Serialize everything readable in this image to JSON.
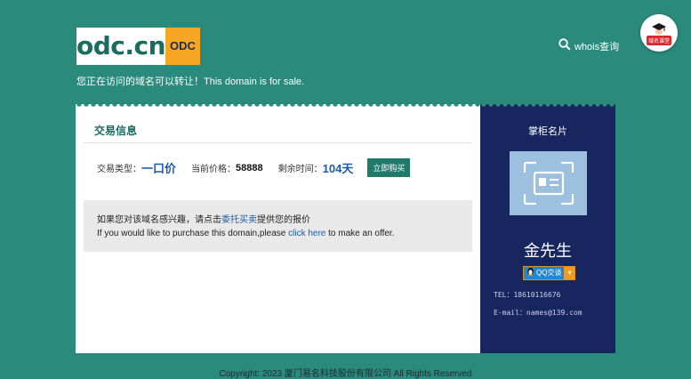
{
  "header": {
    "logo_text": "odc.cn",
    "logo_tag": "ODC",
    "sale_notice": "您正在访问的域名可以转让！This domain is for sale.",
    "whois_label": "whois查询",
    "badge_label": "域名课堂"
  },
  "trade": {
    "title": "交易信息",
    "type_label": "交易类型：",
    "type_value": "一口价",
    "price_label": "当前价格：",
    "price_value": "58888",
    "time_label": "剩余时间：",
    "time_value": "104天",
    "buy_button": "立即购买"
  },
  "offer": {
    "cn_prefix": "如果您对该域名感兴趣，请点击",
    "cn_link": "委托买卖",
    "cn_suffix": "提供您的报价",
    "en_prefix": "If you would like to purchase this domain,please ",
    "en_link": "click here",
    "en_suffix": " to make an offer."
  },
  "seller": {
    "title": "掌柜名片",
    "name": "金先生",
    "qq_label": "QQ交谈",
    "tel_label": "TEL：",
    "tel_value": "18610116676",
    "email_label": "E-mail：",
    "email_value": "names@139.com"
  },
  "footer": {
    "copyright": "Copyright: 2023 厦门易名科技股份有限公司 All Rights Reserved"
  },
  "colors": {
    "background": "#2a8a7c",
    "accent_blue": "#1c5aa8",
    "side_navy": "#182660",
    "logo_orange": "#f5a623"
  }
}
